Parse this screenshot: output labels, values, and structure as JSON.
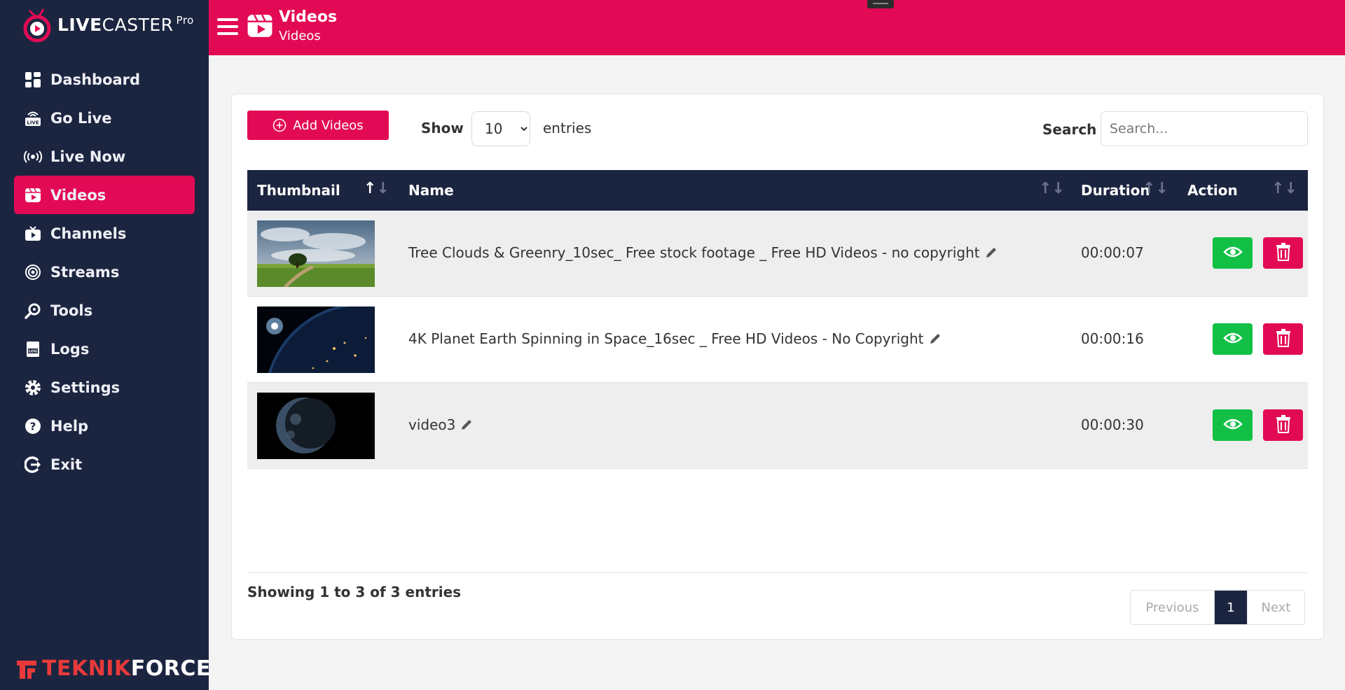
{
  "brand": {
    "logo_bold": "LIVE",
    "logo_thin": "CASTER",
    "logo_sup": "Pro",
    "footer_red": "TEKNIK",
    "footer_white": "FORCE",
    "accent_color": "#e30a55",
    "sidebar_color": "#1c2540"
  },
  "sidebar": {
    "items": [
      {
        "label": "Dashboard",
        "icon": "dashboard-icon"
      },
      {
        "label": "Go Live",
        "icon": "go-live-icon"
      },
      {
        "label": "Live Now",
        "icon": "broadcast-icon"
      },
      {
        "label": "Videos",
        "icon": "video-icon",
        "active": true
      },
      {
        "label": "Channels",
        "icon": "channel-tv-icon"
      },
      {
        "label": "Streams",
        "icon": "streams-icon"
      },
      {
        "label": "Tools",
        "icon": "tools-icon"
      },
      {
        "label": "Logs",
        "icon": "logs-icon"
      },
      {
        "label": "Settings",
        "icon": "gear-icon"
      },
      {
        "label": "Help",
        "icon": "help-icon"
      },
      {
        "label": "Exit",
        "icon": "exit-icon"
      }
    ]
  },
  "header": {
    "title": "Videos",
    "subtitle": "Videos"
  },
  "toolbar": {
    "add_label": "Add Videos",
    "show_label": "Show",
    "entries_value": "10",
    "entries_label": "entries",
    "search_label": "Search",
    "search_placeholder": "Search..."
  },
  "table": {
    "columns": [
      "Thumbnail",
      "Name",
      "Duration",
      "Action"
    ],
    "rows": [
      {
        "name": "Tree Clouds & Greenry_10sec_ Free stock footage _ Free HD Videos - no copyright",
        "duration": "00:00:07",
        "thumb": "landscape"
      },
      {
        "name": "4K Planet Earth Spinning in Space_16sec _ Free HD Videos - No Copyright",
        "duration": "00:00:16",
        "thumb": "earth-limb"
      },
      {
        "name": "video3",
        "duration": "00:00:30",
        "thumb": "earth-globe"
      }
    ]
  },
  "footer": {
    "info": "Showing 1 to 3 of 3 entries",
    "prev": "Previous",
    "page": "1",
    "next": "Next"
  }
}
